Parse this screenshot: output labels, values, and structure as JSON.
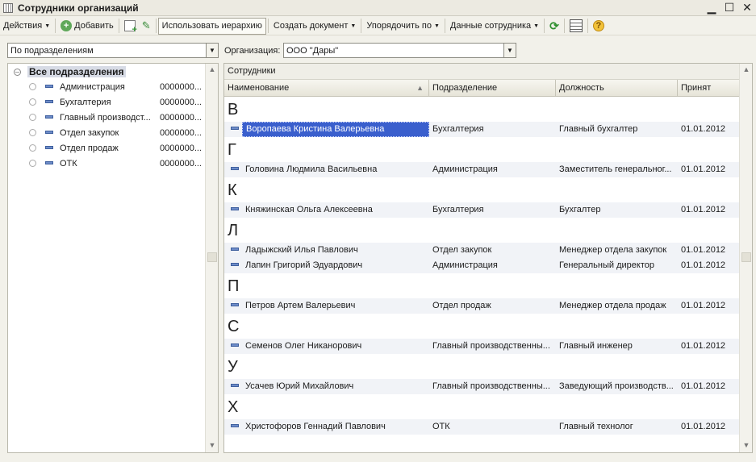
{
  "window": {
    "title": "Сотрудники организаций"
  },
  "toolbar": {
    "actions": "Действия",
    "add": "Добавить",
    "hierarchy": "Использовать иерархию",
    "create_doc": "Создать документ",
    "order_by": "Упорядочить по",
    "employee_data": "Данные сотрудника"
  },
  "filter": {
    "view_mode": "По подразделениям",
    "org_label": "Организация:",
    "org_value": "ООО \"Дары\""
  },
  "tree": {
    "root": "Все подразделения",
    "items": [
      {
        "name": "Администрация",
        "code": "0000000..."
      },
      {
        "name": "Бухгалтерия",
        "code": "0000000..."
      },
      {
        "name": "Главный производст...",
        "code": "0000000..."
      },
      {
        "name": "Отдел закупок",
        "code": "0000000..."
      },
      {
        "name": "Отдел продаж",
        "code": "0000000..."
      },
      {
        "name": "ОТК",
        "code": "0000000..."
      }
    ]
  },
  "grid": {
    "caption": "Сотрудники",
    "columns": [
      "Наименование",
      "Подразделение",
      "Должность",
      "Принят"
    ],
    "groups": [
      {
        "letter": "В",
        "rows": [
          {
            "name": "Воропаева Кристина Валерьевна",
            "dept": "Бухгалтерия",
            "position": "Главный бухгалтер",
            "hired": "01.01.2012",
            "selected": true
          }
        ]
      },
      {
        "letter": "Г",
        "rows": [
          {
            "name": "Головина Людмила Васильевна",
            "dept": "Администрация",
            "position": "Заместитель генеральног...",
            "hired": "01.01.2012"
          }
        ]
      },
      {
        "letter": "К",
        "rows": [
          {
            "name": "Княжинская Ольга Алексеевна",
            "dept": "Бухгалтерия",
            "position": "Бухгалтер",
            "hired": "01.01.2012"
          }
        ]
      },
      {
        "letter": "Л",
        "rows": [
          {
            "name": "Ладыжский Илья Павлович",
            "dept": "Отдел закупок",
            "position": "Менеджер отдела закупок",
            "hired": "01.01.2012"
          },
          {
            "name": "Лапин Григорий Эдуардович",
            "dept": "Администрация",
            "position": "Генеральный директор",
            "hired": "01.01.2012"
          }
        ]
      },
      {
        "letter": "П",
        "rows": [
          {
            "name": "Петров Артем Валерьевич",
            "dept": "Отдел продаж",
            "position": "Менеджер отдела продаж",
            "hired": "01.01.2012"
          }
        ]
      },
      {
        "letter": "С",
        "rows": [
          {
            "name": "Семенов Олег Никанорович",
            "dept": "Главный производственны...",
            "position": "Главный инженер",
            "hired": "01.01.2012"
          }
        ]
      },
      {
        "letter": "У",
        "rows": [
          {
            "name": "Усачев Юрий Михайлович",
            "dept": "Главный производственны...",
            "position": "Заведующий производств...",
            "hired": "01.01.2012"
          }
        ]
      },
      {
        "letter": "Х",
        "rows": [
          {
            "name": "Христофоров Геннадий Павлович",
            "dept": "ОТК",
            "position": "Главный технолог",
            "hired": "01.01.2012"
          }
        ]
      }
    ]
  },
  "colors": {
    "selection": "#3a5fcd",
    "row_stripe": "#f1f3f7",
    "window_bg": "#f2f1ea"
  }
}
